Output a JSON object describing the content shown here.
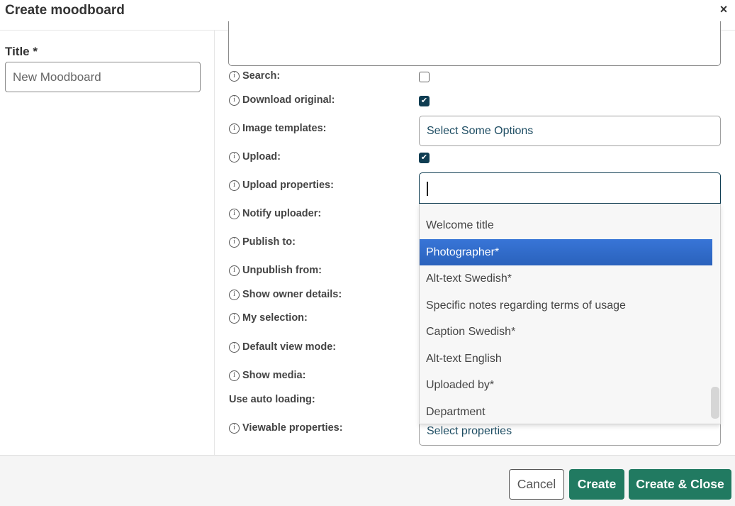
{
  "dialog": {
    "title": "Create moodboard",
    "close_icon": "×"
  },
  "left": {
    "title_label": "Title *",
    "title_value": "New Moodboard"
  },
  "form": {
    "info_icon": "i",
    "rows": [
      {
        "label": "Search:",
        "info": true
      },
      {
        "label": "Download original:",
        "info": true
      },
      {
        "label": "Image templates:",
        "info": true
      },
      {
        "label": "Upload:",
        "info": true
      },
      {
        "label": "Upload properties:",
        "info": true
      },
      {
        "label": "Notify uploader:",
        "info": true
      },
      {
        "label": "Publish to:",
        "info": true
      },
      {
        "label": "Unpublish from:",
        "info": true
      },
      {
        "label": "Show owner details:",
        "info": true
      },
      {
        "label": "My selection:",
        "info": true
      },
      {
        "label": "Default view mode:",
        "info": true
      },
      {
        "label": "Show media:",
        "info": true
      },
      {
        "label": "Use auto loading:",
        "info": false
      },
      {
        "label": "Viewable properties:",
        "info": true
      }
    ],
    "search_checked": false,
    "download_original_checked": true,
    "upload_checked": true,
    "check_glyph": "✔",
    "image_templates_placeholder": "Select Some Options",
    "upload_properties_value": "",
    "viewable_properties_placeholder": "Select properties"
  },
  "dropdown": {
    "items": [
      "Welcome title",
      "Photographer*",
      "Alt-text Swedish*",
      "Specific notes regarding terms of usage",
      "Caption Swedish*",
      "Alt-text English",
      "Uploaded by*",
      "Department"
    ],
    "highlighted_index": 1
  },
  "footer": {
    "cancel": "Cancel",
    "create": "Create",
    "create_close": "Create & Close"
  },
  "colors": {
    "primary": "#217a61",
    "checkbox": "#0f3d52",
    "highlight": "#3875d7"
  }
}
